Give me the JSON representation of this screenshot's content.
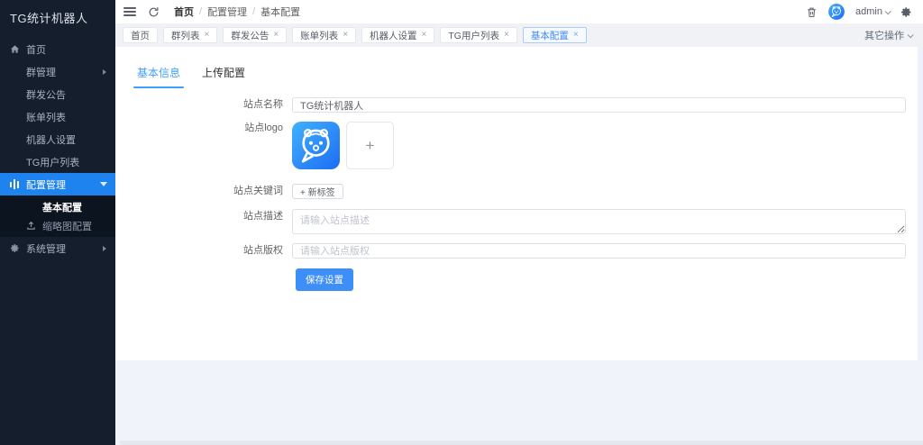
{
  "colors": {
    "sidebar_bg": "#151e2d",
    "submenu_bg": "#0c141f",
    "accent_blue": "#1e83ee",
    "button_blue": "#3e8ef7",
    "tabstrip_bg": "#f0f2f5",
    "active_tab_border": "#a9cdf8",
    "page_bg": "#f0f3fa"
  },
  "sidebar": {
    "title": "TG统计机器人",
    "items": [
      {
        "label": "首页",
        "icon": "home-icon"
      },
      {
        "label": "群管理",
        "icon": "grid-icon",
        "arrow": "right"
      },
      {
        "label": "群发公告",
        "icon": "grid-icon"
      },
      {
        "label": "账单列表",
        "icon": "grid-icon"
      },
      {
        "label": "机器人设置",
        "icon": "grid-icon"
      },
      {
        "label": "TG用户列表",
        "icon": "grid-icon"
      },
      {
        "label": "配置管理",
        "icon": "bar-chart-icon",
        "arrow": "down",
        "active": true
      }
    ],
    "submenu": [
      {
        "label": "基本配置",
        "icon": "grid-icon",
        "active": true
      },
      {
        "label": "缩略图配置",
        "icon": "upload-icon"
      }
    ],
    "after_submenu": [
      {
        "label": "系统管理",
        "icon": "gear-icon",
        "arrow": "right"
      }
    ]
  },
  "header": {
    "breadcrumb": {
      "home": "首页",
      "sep1": "/",
      "section": "配置管理",
      "sep2": "/",
      "page": "基本配置"
    },
    "username": "admin"
  },
  "tabstrip": {
    "tabs": [
      {
        "label": "首页"
      },
      {
        "label": "群列表",
        "close": "×"
      },
      {
        "label": "群发公告",
        "close": "×"
      },
      {
        "label": "账单列表",
        "close": "×"
      },
      {
        "label": "机器人设置",
        "close": "×"
      },
      {
        "label": "TG用户列表",
        "close": "×"
      },
      {
        "label": "基本配置",
        "close": "×",
        "active": true
      }
    ],
    "more_label": "其它操作"
  },
  "content": {
    "tabs": {
      "basic": "基本信息",
      "upload": "上传配置"
    },
    "form": {
      "site_name_label": "站点名称",
      "site_name_value": "TG统计机器人",
      "site_logo_label": "站点logo",
      "upload_plus": "+",
      "site_keywords_label": "站点关键词",
      "add_tag_label": "+ 新标签",
      "site_desc_label": "站点描述",
      "site_desc_placeholder": "请输入站点描述",
      "site_copyright_label": "站点版权",
      "site_copyright_placeholder": "请输入站点版权",
      "save_label": "保存设置"
    }
  }
}
